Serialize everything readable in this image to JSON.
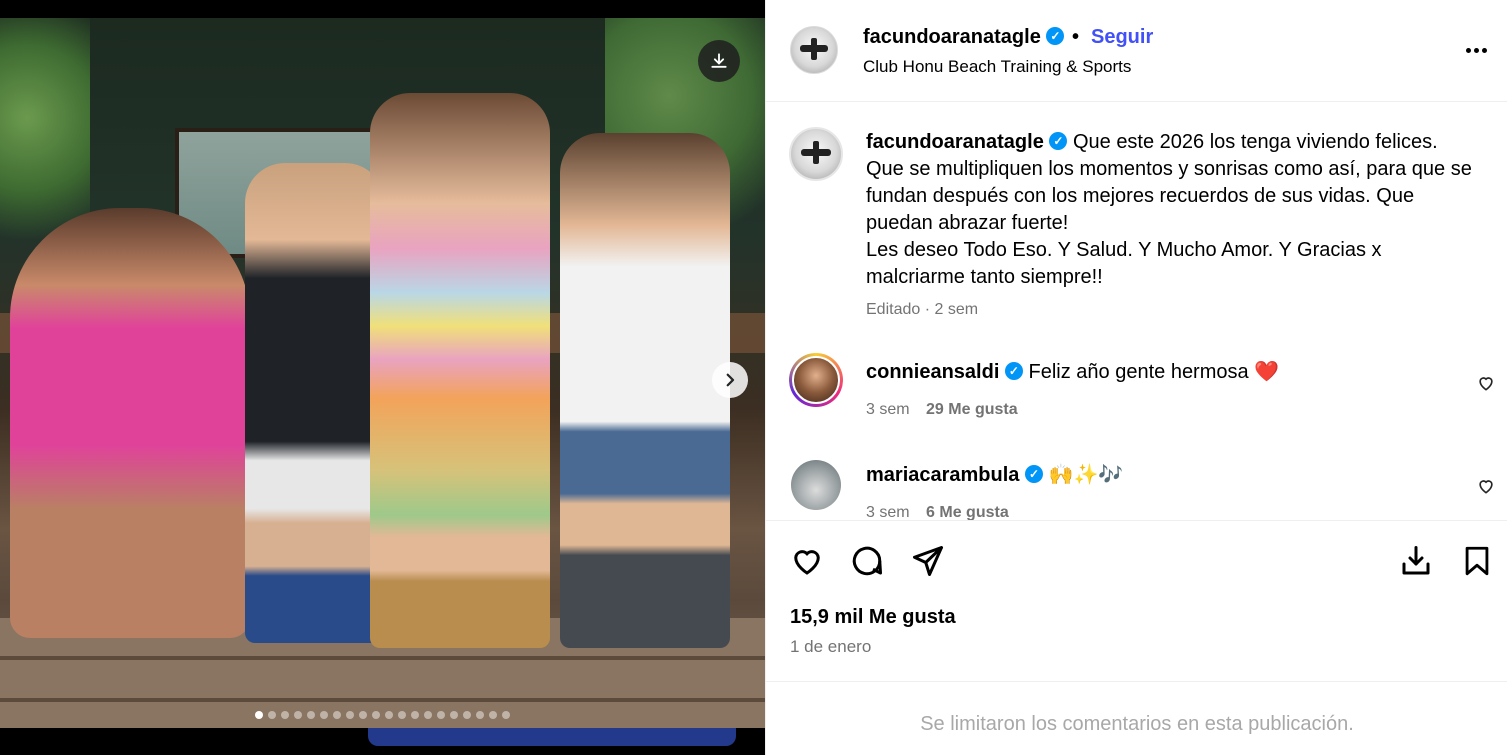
{
  "media": {
    "slides_total": 20,
    "active_slide": 1,
    "icons": {
      "download": "download-icon",
      "next": "chevron-right-icon"
    }
  },
  "header": {
    "username": "facundoaranatagle",
    "separator": "•",
    "follow_label": "Seguir",
    "location": "Club Honu Beach Training & Sports",
    "more_icon": "more-horizontal-icon"
  },
  "caption": {
    "username": "facundoaranatagle",
    "text": "Que este 2026 los tenga viviendo felices. Que se multipliquen los momentos y sonrisas como así, para que se fundan después con los mejores recuerdos de sus vidas. Que puedan abrazar fuerte! Les deseo Todo Eso. Y Salud. Y Mucho Amor. Y Gracias x malcriarme tanto siempre!!",
    "line1": "Que este 2026 los tenga viviendo felices.",
    "line2": "Que se multipliquen los momentos y sonrisas como así, para que se fundan después con los mejores recuerdos de sus vidas. Que puedan abrazar fuerte!",
    "line3": "Les deseo Todo Eso. Y Salud. Y Mucho Amor. Y Gracias x malcriarme tanto siempre!!",
    "edited": "Editado",
    "meta_separator": "·",
    "time": "2 sem"
  },
  "comments": [
    {
      "username": "connieansaldi",
      "text": "Feliz año gente hermosa ❤️",
      "time": "3 sem",
      "likes": "29 Me gusta"
    },
    {
      "username": "mariacarambula",
      "text": "🙌✨🎶",
      "time": "3 sem",
      "likes": "6 Me gusta"
    }
  ],
  "actions": {
    "like_icon": "heart-icon",
    "comment_icon": "comment-icon",
    "share_icon": "send-icon",
    "download_icon": "download-icon",
    "save_icon": "bookmark-icon",
    "likes_count": "15,9 mil Me gusta",
    "date": "1 de enero"
  },
  "footer": {
    "limited_text": "Se limitaron los comentarios en esta publicación."
  },
  "colors": {
    "follow": "#4150f7",
    "verified": "#0095f6",
    "muted": "#737373",
    "heart_red": "#ed4956"
  }
}
